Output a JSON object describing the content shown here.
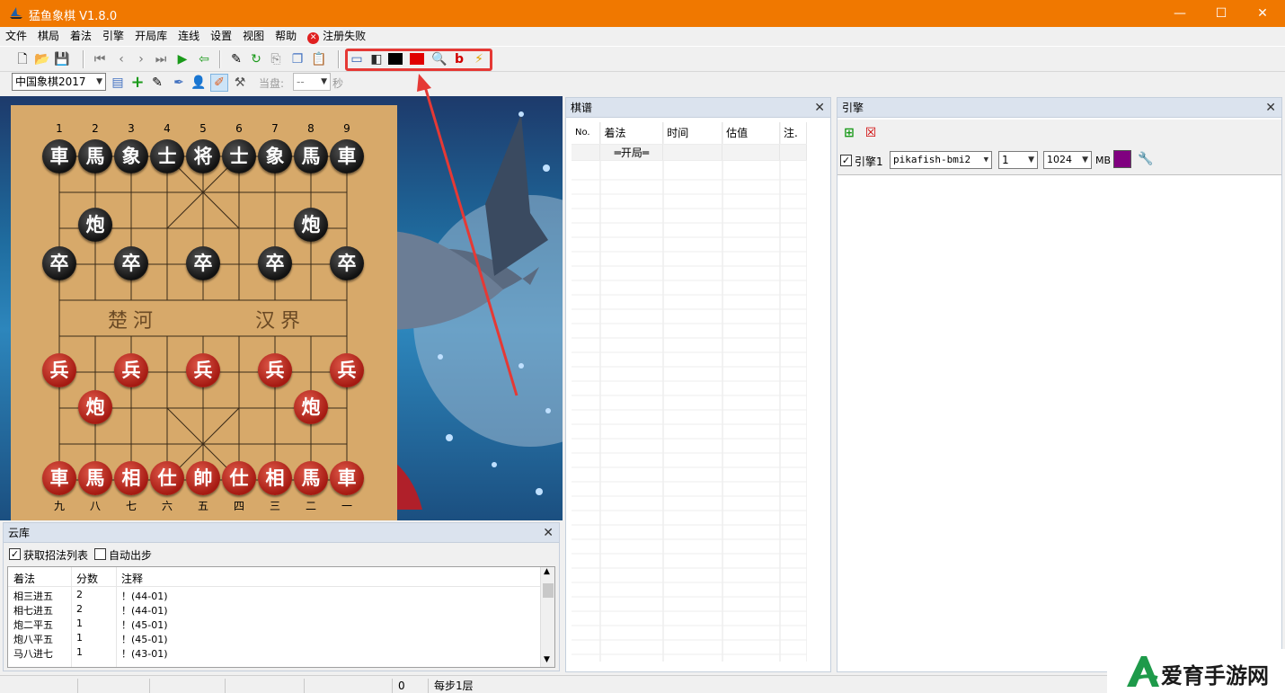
{
  "window": {
    "title": "猛鱼象棋 V1.8.0"
  },
  "menu": [
    "文件",
    "棋局",
    "着法",
    "引擎",
    "开局库",
    "连线",
    "设置",
    "视图",
    "帮助",
    "注册失败"
  ],
  "toolbar2": {
    "game_type": "中国象棋2017",
    "current_label": "当盘:",
    "current_value": "--",
    "seconds_label": "秒"
  },
  "board": {
    "top_files": [
      "1",
      "2",
      "3",
      "4",
      "5",
      "6",
      "7",
      "8",
      "9"
    ],
    "bottom_files": [
      "九",
      "八",
      "七",
      "六",
      "五",
      "四",
      "三",
      "二",
      "一"
    ],
    "river_left": "楚河",
    "river_right": "汉界",
    "black_back": [
      "車",
      "馬",
      "象",
      "士",
      "将",
      "士",
      "象",
      "馬",
      "車"
    ],
    "red_back": [
      "車",
      "馬",
      "相",
      "仕",
      "帥",
      "仕",
      "相",
      "馬",
      "車"
    ],
    "black_cannon": "炮",
    "black_pawn": "卒",
    "red_cannon": "炮",
    "red_pawn": "兵"
  },
  "qipu": {
    "title": "棋谱",
    "headers": [
      "No.",
      "着法",
      "时间",
      "估值",
      "注."
    ],
    "first_row": "═开局═"
  },
  "engine": {
    "title": "引擎",
    "engine_label": "引擎1",
    "engine_name": "pikafish-bmi2",
    "threads": "1",
    "hash": "1024",
    "hash_unit": "MB",
    "color": "#800080"
  },
  "yunku": {
    "title": "云库",
    "get_list": "获取招法列表",
    "auto_move": "自动出步",
    "headers": [
      "着法",
      "分数",
      "注释"
    ],
    "rows": [
      {
        "move": "相三进五",
        "score": "2",
        "note": "！(44-01)"
      },
      {
        "move": "相七进五",
        "score": "2",
        "note": "！(44-01)"
      },
      {
        "move": "炮二平五",
        "score": "1",
        "note": "！(45-01)"
      },
      {
        "move": "炮八平五",
        "score": "1",
        "note": "！(45-01)"
      },
      {
        "move": "马八进七",
        "score": "1",
        "note": "！(43-01)"
      }
    ]
  },
  "status": {
    "count": "0",
    "depth": "每步1层"
  },
  "watermark": {
    "text": "爱育手游网"
  },
  "colors": {
    "titlebar": "#f07800",
    "highlight": "#e53935"
  }
}
